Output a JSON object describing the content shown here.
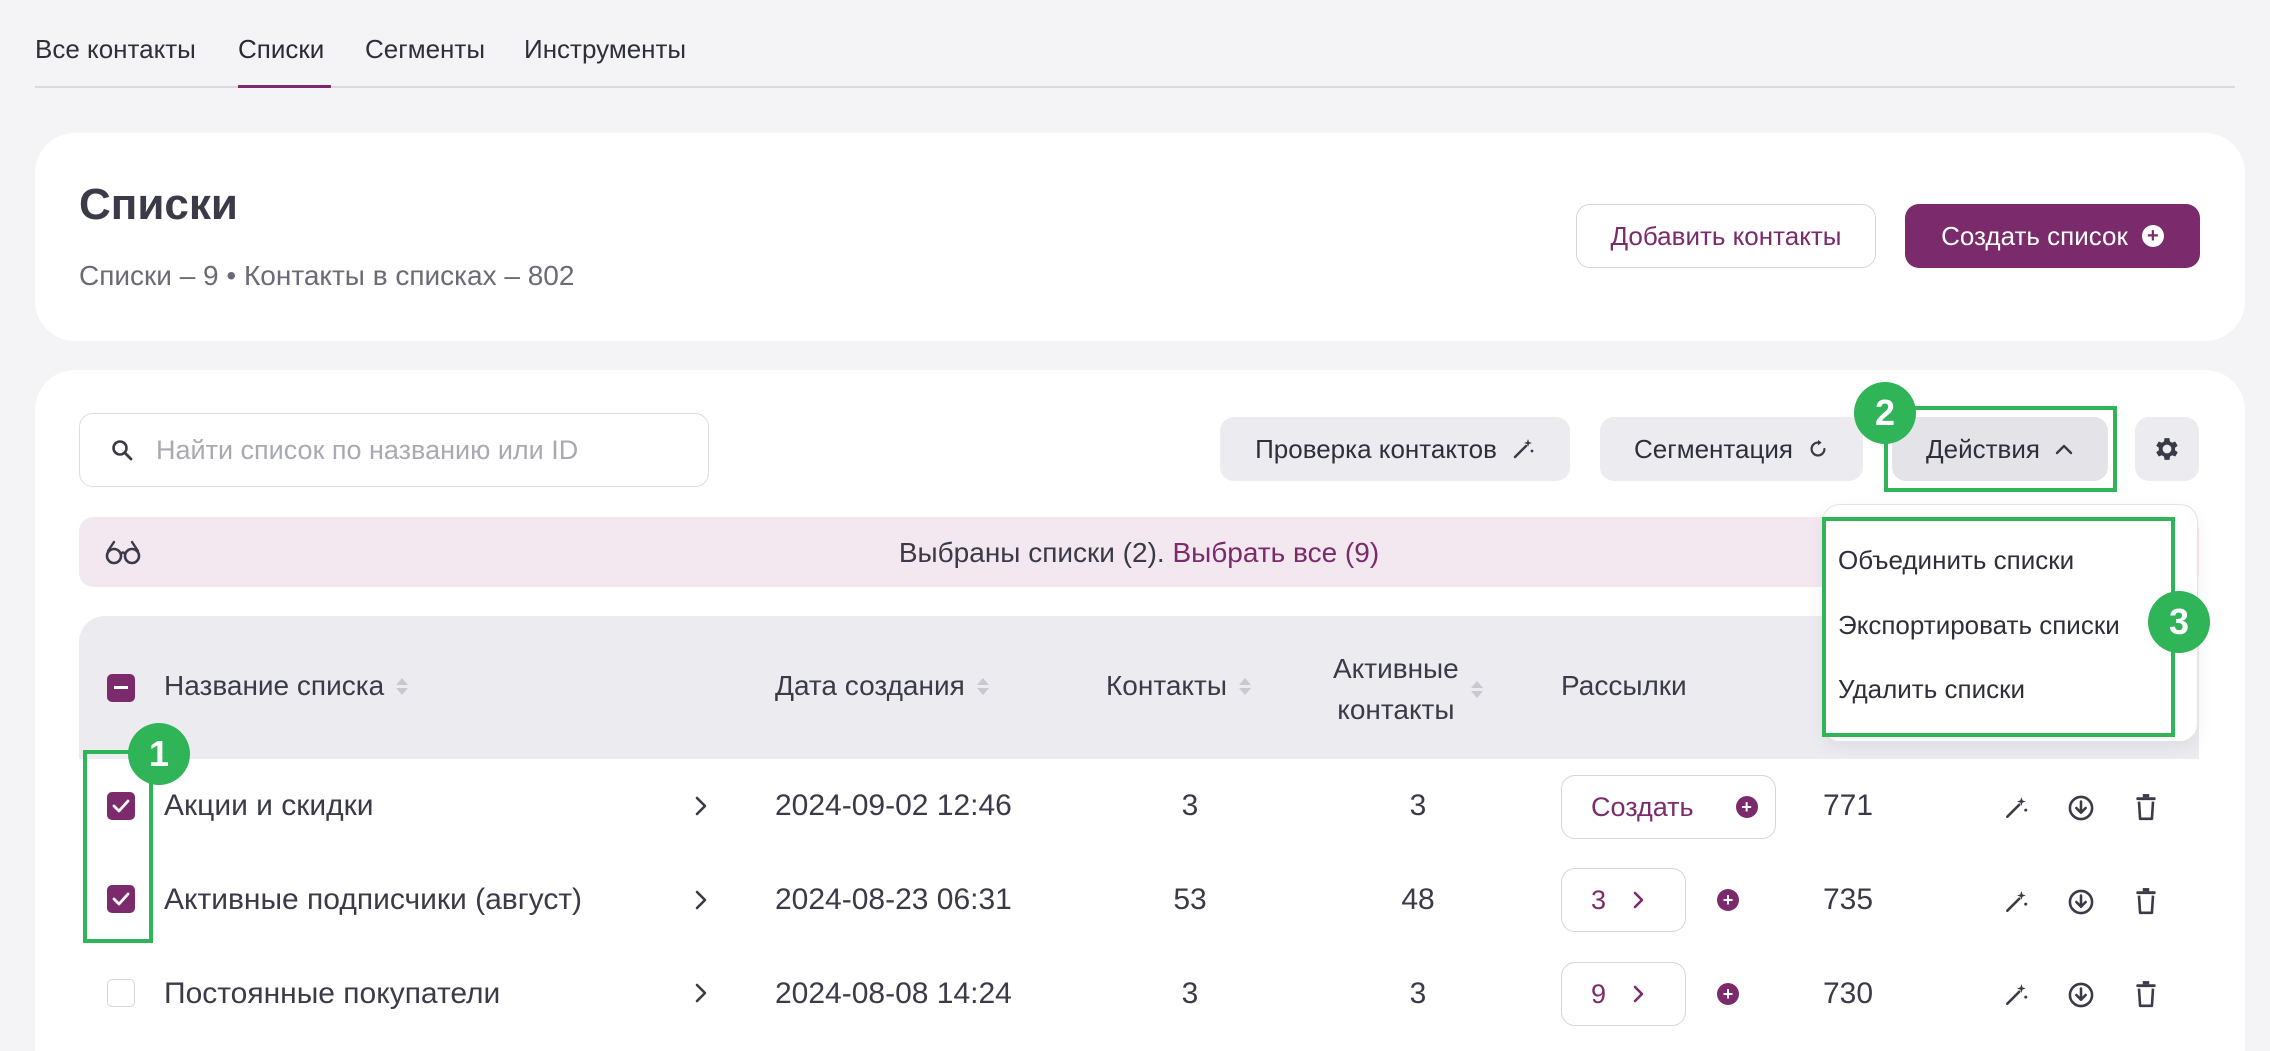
{
  "tabs": [
    {
      "label": "Все контакты"
    },
    {
      "label": "Списки",
      "active": true
    },
    {
      "label": "Сегменты"
    },
    {
      "label": "Инструменты"
    }
  ],
  "header": {
    "title": "Списки",
    "subtitle": "Списки – 9 • Контакты в списках – 802",
    "add_contacts_label": "Добавить контакты",
    "create_list_label": "Создать список"
  },
  "toolbar": {
    "search_placeholder": "Найти список по названию или ID",
    "check_contacts_label": "Проверка контактов",
    "segmentation_label": "Сегментация",
    "actions_label": "Действия"
  },
  "banner": {
    "text": "Выбраны списки (2).",
    "select_all_label": "Выбрать все (9)"
  },
  "table": {
    "columns": {
      "name": "Название списка",
      "created": "Дата создания",
      "contacts": "Контакты",
      "active_line1": "Активные",
      "active_line2": "контакты",
      "mailings": "Рассылки"
    },
    "rows": [
      {
        "name": "Акции и скидки",
        "created": "2024-09-02 12:46",
        "contacts": "3",
        "active": "3",
        "mailing_label": "Создать",
        "id": "771",
        "checked": true
      },
      {
        "name": "Активные подписчики (август)",
        "created": "2024-08-23 06:31",
        "contacts": "53",
        "active": "48",
        "mailing_label": "3",
        "id": "735",
        "checked": true
      },
      {
        "name": "Постоянные покупатели",
        "created": "2024-08-08 14:24",
        "contacts": "3",
        "active": "3",
        "mailing_label": "9",
        "id": "730",
        "checked": false
      }
    ]
  },
  "actions_menu": {
    "items": [
      {
        "label": "Объединить списки"
      },
      {
        "label": "Экспортировать списки"
      },
      {
        "label": "Удалить списки"
      }
    ]
  },
  "annotations": {
    "badge_1": "1",
    "badge_2": "2",
    "badge_3": "3"
  },
  "colors": {
    "accent": "#7b2a6c",
    "annotation_green": "#2fb457",
    "banner_bg": "#f3e8ef"
  }
}
